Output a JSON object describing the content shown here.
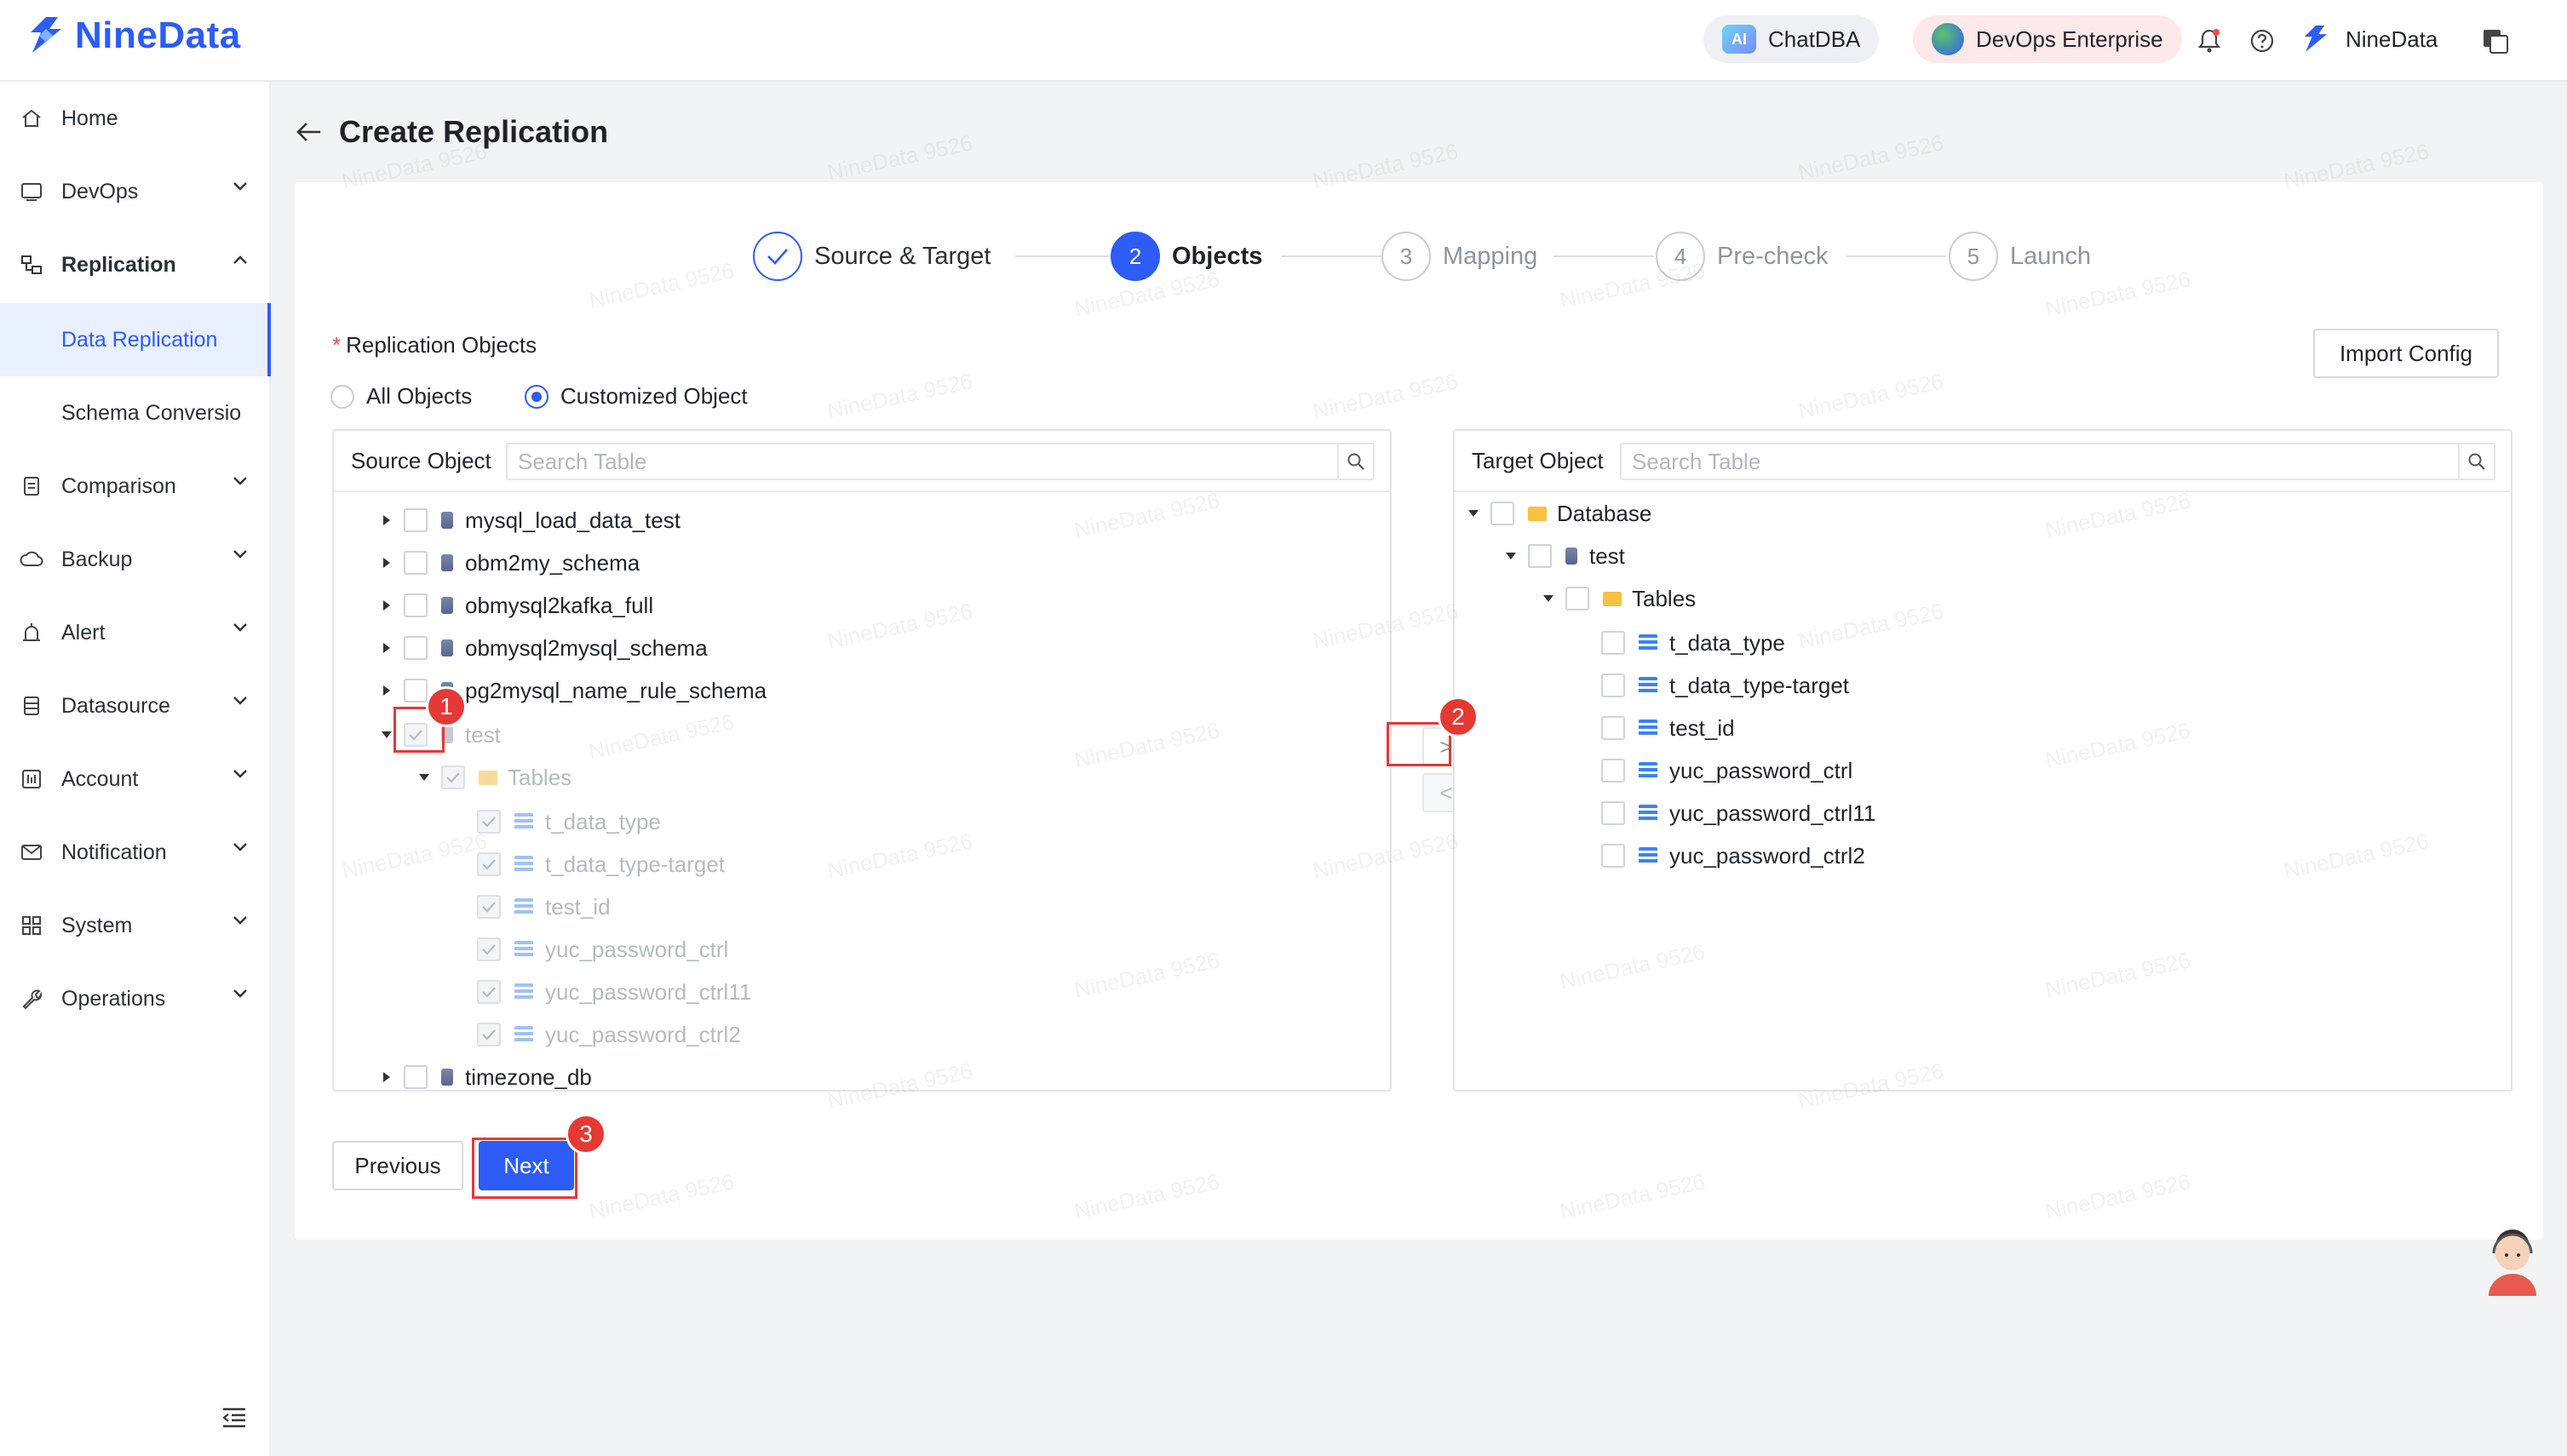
{
  "app": {
    "name": "NineData"
  },
  "topbar": {
    "chatdba": "ChatDBA",
    "devops": "DevOps Enterprise",
    "user": "NineData"
  },
  "sidebar": {
    "items": [
      {
        "label": "Home",
        "icon": "home-icon"
      },
      {
        "label": "DevOps",
        "icon": "sql-icon"
      },
      {
        "label": "Replication",
        "icon": "replication-icon"
      },
      {
        "label": "Data Replication"
      },
      {
        "label": "Schema Conversio"
      },
      {
        "label": "Comparison",
        "icon": "comparison-icon"
      },
      {
        "label": "Backup",
        "icon": "backup-icon"
      },
      {
        "label": "Alert",
        "icon": "alert-icon"
      },
      {
        "label": "Datasource",
        "icon": "datasource-icon"
      },
      {
        "label": "Account",
        "icon": "account-icon"
      },
      {
        "label": "Notification",
        "icon": "mail-icon"
      },
      {
        "label": "System",
        "icon": "system-icon"
      },
      {
        "label": "Operations",
        "icon": "wrench-icon"
      }
    ]
  },
  "page": {
    "title": "Create Replication"
  },
  "steps": [
    {
      "num": "",
      "label": "Source & Target",
      "state": "done"
    },
    {
      "num": "2",
      "label": "Objects",
      "state": "current"
    },
    {
      "num": "3",
      "label": "Mapping",
      "state": "todo"
    },
    {
      "num": "4",
      "label": "Pre-check",
      "state": "todo"
    },
    {
      "num": "5",
      "label": "Launch",
      "state": "todo"
    }
  ],
  "form": {
    "objects_label": "Replication Objects",
    "required_mark": "*",
    "option_all": "All Objects",
    "option_custom": "Customized Object",
    "selected_option": "Customized Object",
    "import_button": "Import Config"
  },
  "source": {
    "header": "Source Object",
    "search_placeholder": "Search Table",
    "tree": [
      {
        "label": "mysql_load_data_test"
      },
      {
        "label": "obm2my_schema"
      },
      {
        "label": "obmysql2kafka_full"
      },
      {
        "label": "obmysql2mysql_schema"
      },
      {
        "label": "pg2mysql_name_rule_schema"
      },
      {
        "label": "test"
      },
      {
        "label": "Tables"
      },
      {
        "label": "t_data_type"
      },
      {
        "label": "t_data_type-target"
      },
      {
        "label": "test_id"
      },
      {
        "label": "yuc_password_ctrl"
      },
      {
        "label": "yuc_password_ctrl11"
      },
      {
        "label": "yuc_password_ctrl2"
      },
      {
        "label": "timezone_db"
      }
    ]
  },
  "target": {
    "header": "Target Object",
    "search_placeholder": "Search Table",
    "tree": [
      {
        "label": "Database"
      },
      {
        "label": "test"
      },
      {
        "label": "Tables"
      },
      {
        "label": "t_data_type"
      },
      {
        "label": "t_data_type-target"
      },
      {
        "label": "test_id"
      },
      {
        "label": "yuc_password_ctrl"
      },
      {
        "label": "yuc_password_ctrl11"
      },
      {
        "label": "yuc_password_ctrl2"
      }
    ]
  },
  "transfer": {
    "right": ">",
    "left": "<"
  },
  "footer": {
    "previous": "Previous",
    "next": "Next"
  },
  "annotations": {
    "badge1": "1",
    "badge2": "2",
    "badge3": "3",
    "highlight_color": "#e53935"
  },
  "watermark": "NineData 9526",
  "colors": {
    "accent": "#2d5cf6",
    "required": "#f54a45"
  }
}
